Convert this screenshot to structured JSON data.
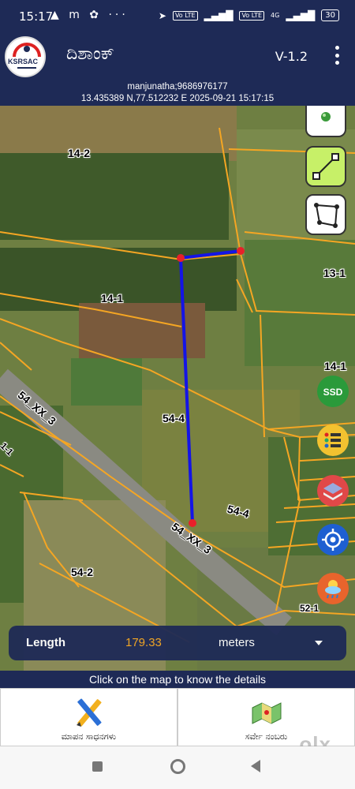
{
  "status_bar": {
    "time": "15:17",
    "left_icons": "▲ m ✿ ···",
    "net_tags": [
      "Vo LTE",
      "Vo LTE"
    ],
    "network": "4G",
    "battery": "30"
  },
  "app_bar": {
    "logo_text": "KSRSAC",
    "title": "ದಿಶಾಂಕ್",
    "version": "V-1.2"
  },
  "user_info": {
    "user": "manjunatha;9686976177",
    "coords_time": "13.435389 N,77.512232 E   2025-09-21 15:17:15"
  },
  "map": {
    "plot_labels": [
      "14-2",
      "14-1",
      "13-1",
      "14-1",
      "54-4",
      "54_XX_3",
      "54-4",
      "54_XX_3",
      "54-2",
      "52-1",
      "1-1"
    ],
    "side_buttons": [
      "point-tool",
      "line-tool",
      "polygon-tool",
      "ssd-layer",
      "legend-list",
      "layers",
      "gps-locate",
      "weather"
    ]
  },
  "measurement": {
    "label": "Length",
    "value": "179.33",
    "unit": "meters"
  },
  "hint": "Click on the map to know the details",
  "bottom_nav": [
    {
      "label": "ಮಾಪನ ಸಾಧನಗಳು",
      "icon": "measure-tools-icon"
    },
    {
      "label": "ಸರ್ವೇ ನಂಬರು",
      "icon": "survey-number-icon"
    }
  ],
  "watermark": "olx",
  "colors": {
    "header": "#1e2a56",
    "boundary": "#f5a623",
    "measure_line": "#1414e6",
    "vertex": "#e8202a",
    "length_value": "#f5a623",
    "active_tool": "#c7f068"
  }
}
